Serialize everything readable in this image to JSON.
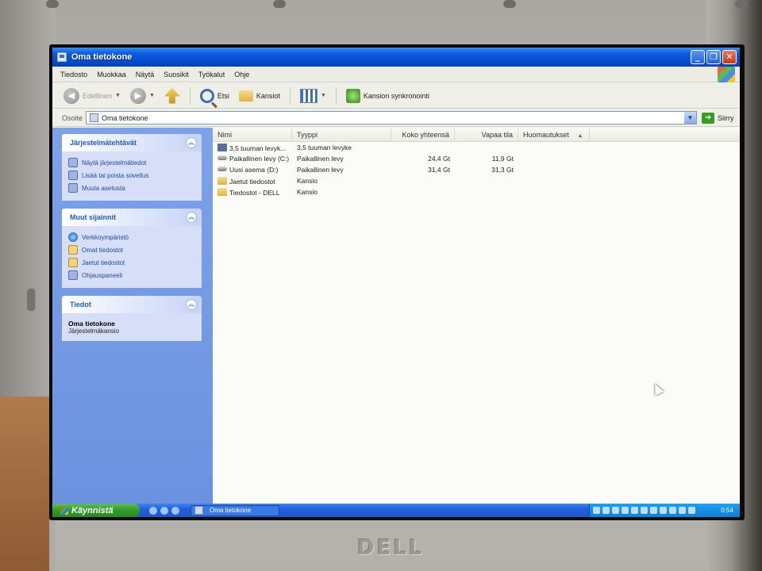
{
  "window": {
    "title": "Oma tietokone",
    "buttons": {
      "minimize": "_",
      "maximize": "❐",
      "close": "✕"
    }
  },
  "menu": [
    "Tiedosto",
    "Muokkaa",
    "Näytä",
    "Suosikit",
    "Työkalut",
    "Ohje"
  ],
  "toolbar": {
    "back_label": "Edellinen",
    "search_label": "Etsi",
    "folders_label": "Kansiot",
    "sync_label": "Kansion synkronointi"
  },
  "address": {
    "label": "Osoite",
    "value": "Oma tietokone",
    "go_label": "Siirry"
  },
  "taskpane": {
    "system_tasks": {
      "title": "Järjestelmätehtävät",
      "items": [
        "Näytä järjestelmätiedot",
        "Lisää tai poista sovellus",
        "Muuta asetusta"
      ]
    },
    "other_places": {
      "title": "Muut sijainnit",
      "items": [
        "Verkkoympäristö",
        "Omat tiedostot",
        "Jaetut tiedostot",
        "Ohjauspaneeli"
      ]
    },
    "details": {
      "title": "Tiedot",
      "name": "Oma tietokone",
      "subtitle": "Järjestelmäkansio"
    }
  },
  "filelist": {
    "columns": [
      "Nimi",
      "Tyyppi",
      "Koko yhteensä",
      "Vapaa tila",
      "Huomautukset"
    ],
    "rows": [
      {
        "name": "3,5 tuuman levyk...",
        "type": "3,5 tuuman levyke",
        "size": "",
        "free": "",
        "icon": "floppy-icon"
      },
      {
        "name": "Paikallinen levy (C:)",
        "type": "Paikallinen levy",
        "size": "24,4 Gt",
        "free": "11,9 Gt",
        "icon": "drive-icon"
      },
      {
        "name": "Uusi asema (D:)",
        "type": "Paikallinen levy",
        "size": "31,4 Gt",
        "free": "31,3 Gt",
        "icon": "drive-icon"
      },
      {
        "name": "Jaetut tiedostot",
        "type": "Kansio",
        "size": "",
        "free": "",
        "icon": "folder-icon"
      },
      {
        "name": "Tiedostot - DELL",
        "type": "Kansio",
        "size": "",
        "free": "",
        "icon": "folder-icon"
      }
    ]
  },
  "taskbar": {
    "start_label": "Käynnistä",
    "task_label": "Oma tietokone",
    "clock": "0:54"
  },
  "bezel": {
    "brand": "DELL"
  },
  "colors": {
    "titlebar": "#0a5ee0",
    "taskpane": "#7da2e8",
    "start": "#2f9a2a",
    "link": "#1f4aa8"
  }
}
